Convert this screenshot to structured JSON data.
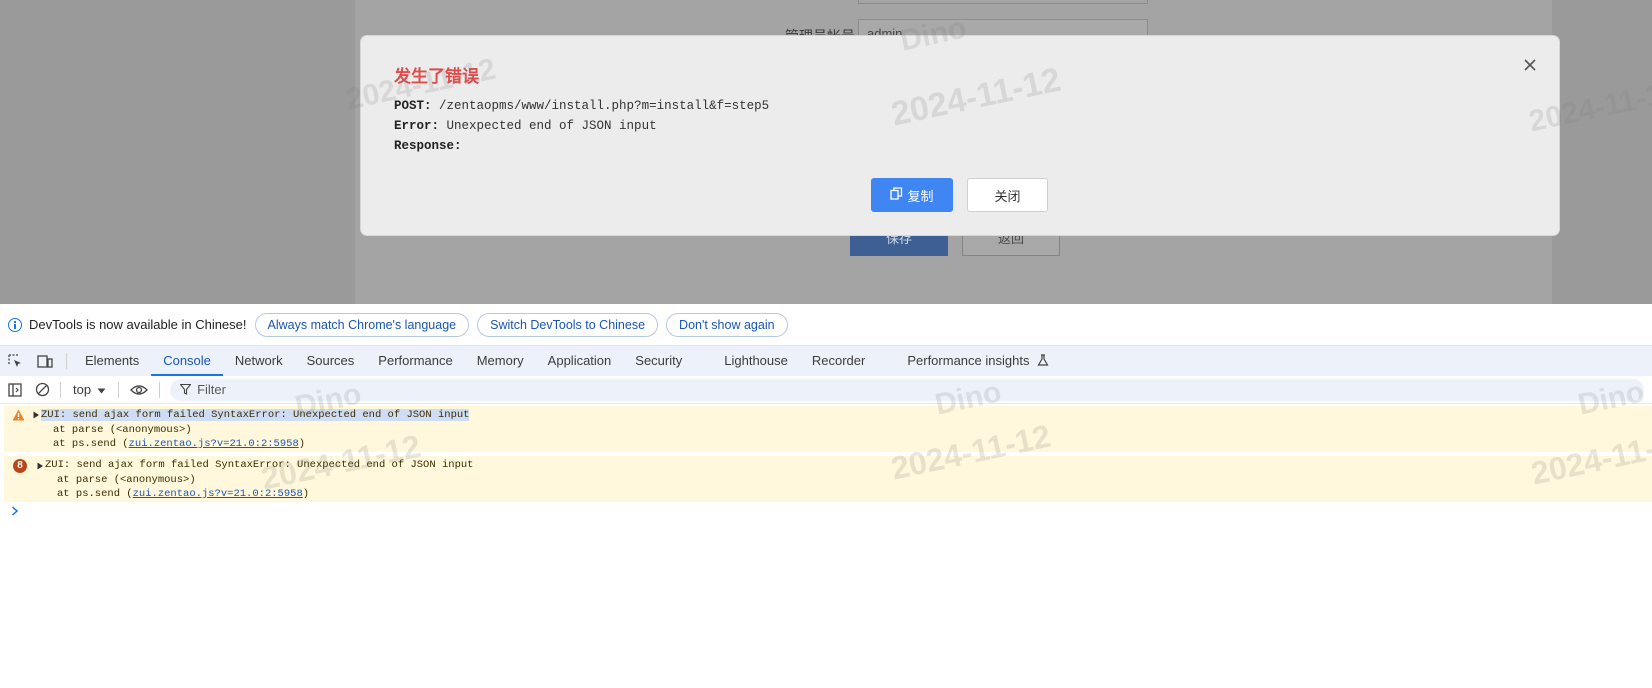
{
  "background_page": {
    "field_label": "管理员帐号",
    "field_value": "admin",
    "save_label": "保存",
    "back_label": "返回"
  },
  "modal": {
    "title": "发生了错误",
    "lines": [
      {
        "key": "POST:",
        "value": "/zentaopms/www/install.php?m=install&f=step5"
      },
      {
        "key": "Error:",
        "value": "Unexpected end of JSON input"
      },
      {
        "key": "Response:",
        "value": ""
      }
    ],
    "copy_label": "复制",
    "close_label": "关闭"
  },
  "devtools": {
    "infobar": {
      "message": "DevTools is now available in Chinese!",
      "buttons": [
        "Always match Chrome's language",
        "Switch DevTools to Chinese",
        "Don't show again"
      ]
    },
    "tabs": [
      "Elements",
      "Console",
      "Network",
      "Sources",
      "Performance",
      "Memory",
      "Application",
      "Security",
      "Lighthouse",
      "Recorder",
      "Performance insights"
    ],
    "active_tab": "Console",
    "toolbar": {
      "context": "top",
      "filter_placeholder": "Filter"
    },
    "messages": [
      {
        "level": "warning",
        "text": "ZUI: send ajax form failed SyntaxError: Unexpected end of JSON input",
        "stack": [
          "at parse (<anonymous>)",
          "at ps.send ("
        ],
        "link": "zui.zentao.js?v=21.0:2:5958"
      },
      {
        "level": "error",
        "count": "8",
        "text": "ZUI: send ajax form failed SyntaxError: Unexpected end of JSON input",
        "stack": [
          "at parse (<anonymous>)",
          "at ps.send ("
        ],
        "link": "zui.zentao.js?v=21.0:2:5958"
      }
    ]
  },
  "watermark": {
    "name": "Dino",
    "date": "2024-11-12"
  },
  "colors": {
    "accent": "#1a73e8",
    "error_title": "#e34b4b",
    "primary_button": "#3f86f3",
    "message_bg": "#fff8dc"
  }
}
